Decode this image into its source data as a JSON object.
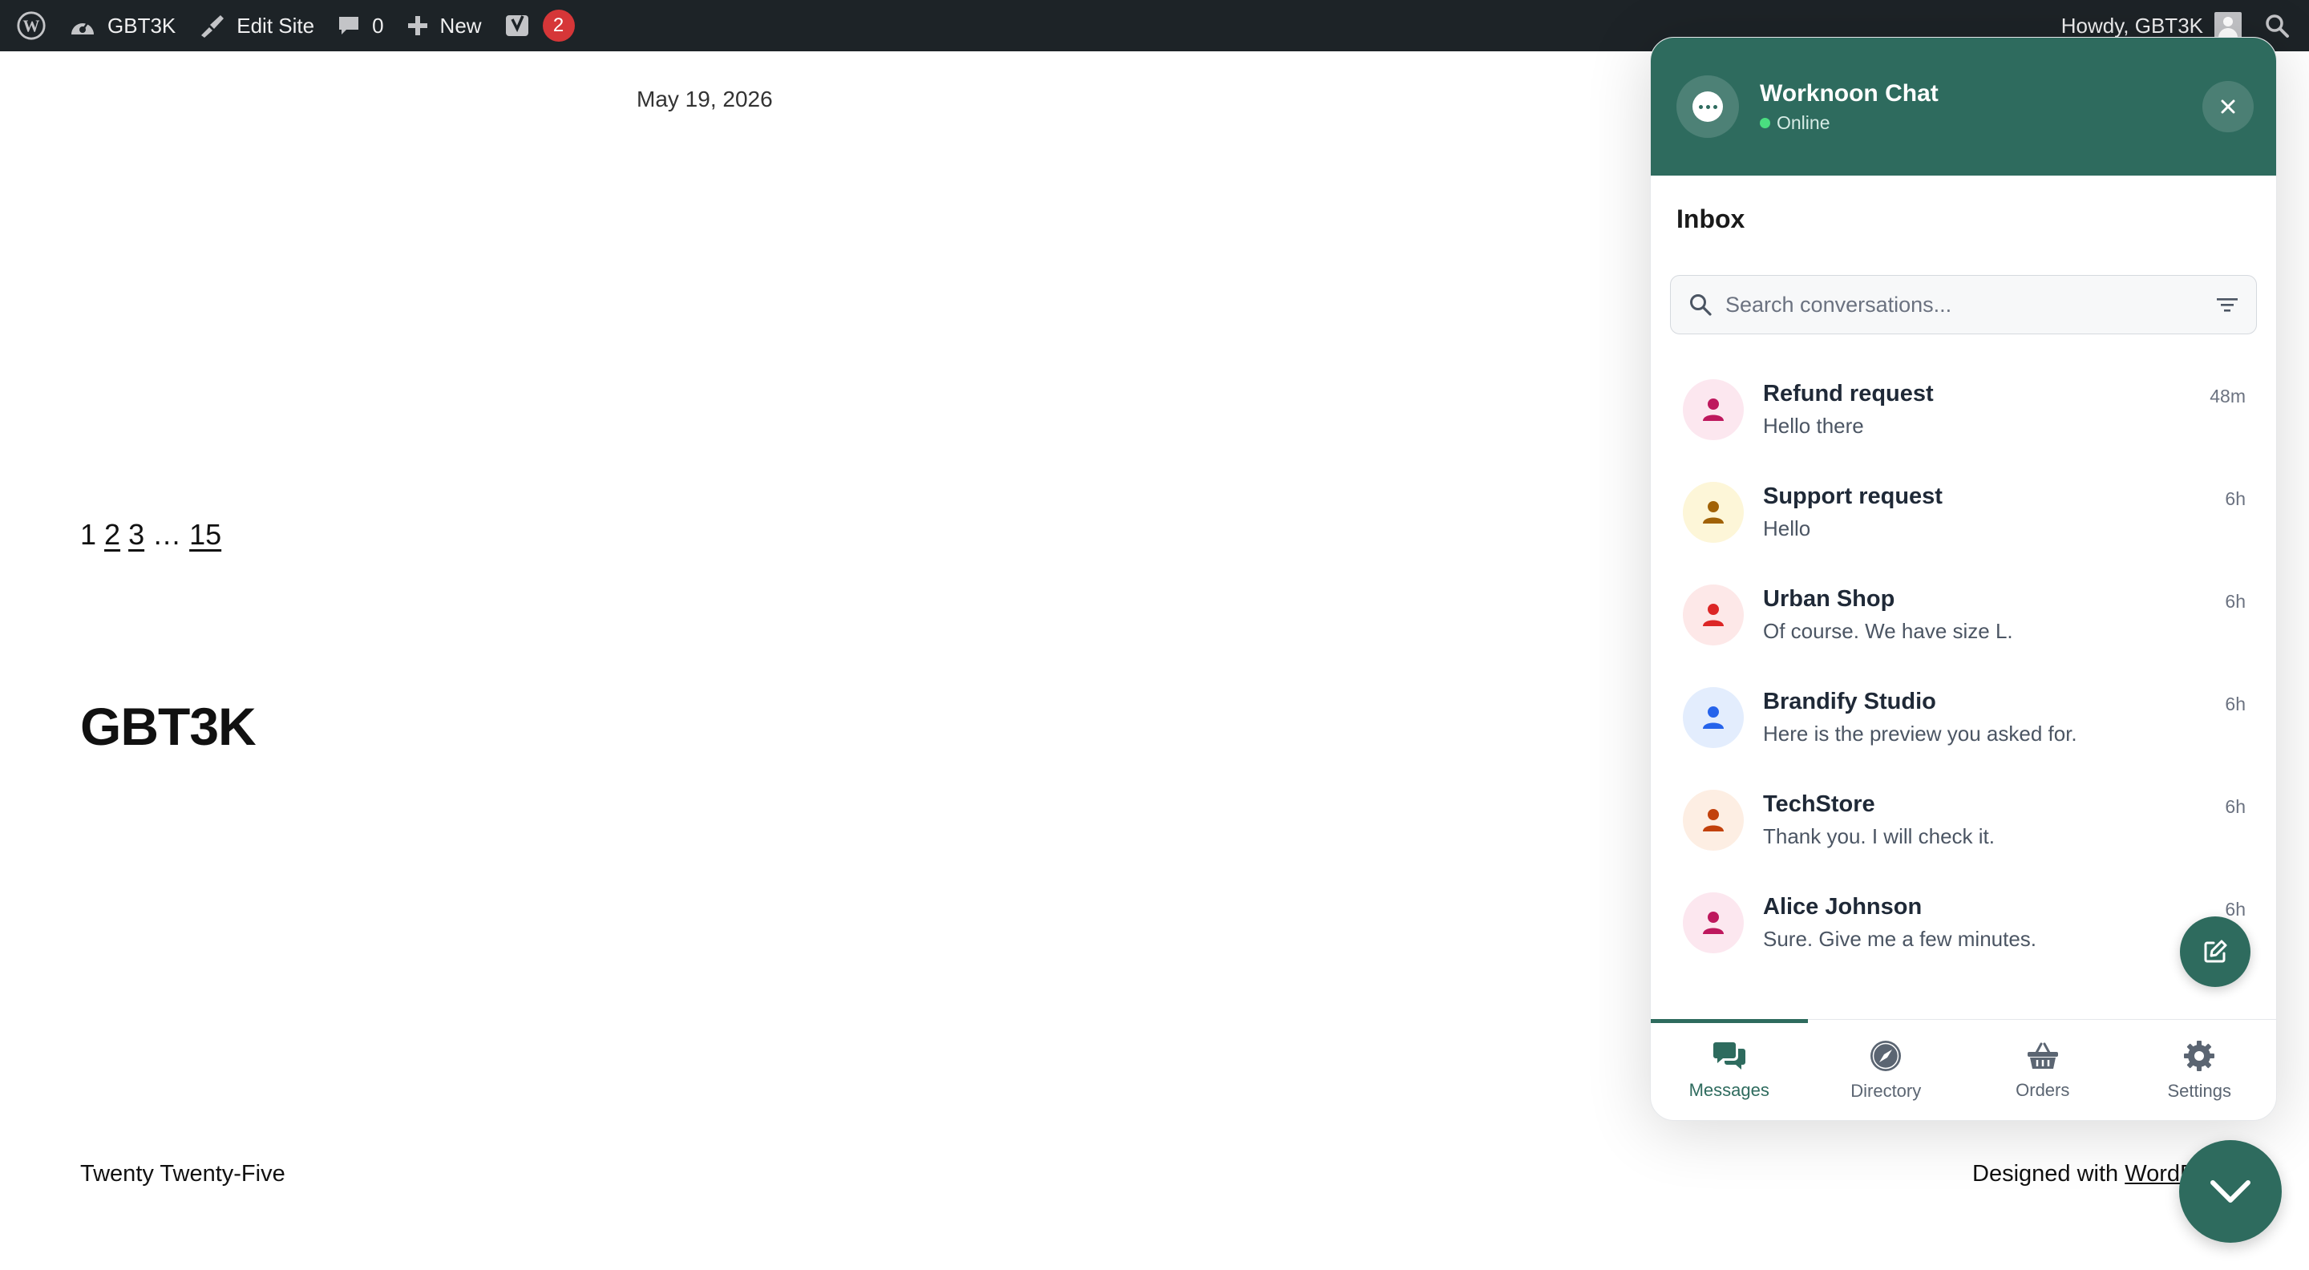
{
  "adminbar": {
    "site_name": "GBT3K",
    "edit_site": "Edit Site",
    "comments_count": "0",
    "new_label": "New",
    "yoast_badge": "2",
    "howdy": "Howdy, GBT3K"
  },
  "page": {
    "post_date": "May 19, 2026",
    "pagination": {
      "current": "1",
      "pages": [
        "2",
        "3"
      ],
      "ellipsis": "…",
      "last": "15"
    },
    "site_title": "GBT3K",
    "footer_left": "Twenty Twenty-Five",
    "footer_right_prefix": "Designed with ",
    "footer_right_link": "WordPress"
  },
  "widget": {
    "title": "Worknoon Chat",
    "status": "Online",
    "inbox_title": "Inbox",
    "search_placeholder": "Search conversations...",
    "conversations": [
      {
        "name": "Refund request",
        "preview": "Hello there",
        "time": "48m",
        "avatar_bg": "#fce7ef",
        "avatar_fg": "#be185d"
      },
      {
        "name": "Support request",
        "preview": "Hello",
        "time": "6h",
        "avatar_bg": "#fdf6d8",
        "avatar_fg": "#a16207"
      },
      {
        "name": "Urban Shop",
        "preview": "Of course. We have size L.",
        "time": "6h",
        "avatar_bg": "#fde8e8",
        "avatar_fg": "#dc2626"
      },
      {
        "name": "Brandify Studio",
        "preview": "Here is the preview you asked for.",
        "time": "6h",
        "avatar_bg": "#e3edfd",
        "avatar_fg": "#2563eb"
      },
      {
        "name": "TechStore",
        "preview": "Thank you. I will check it.",
        "time": "6h",
        "avatar_bg": "#fdeee3",
        "avatar_fg": "#c2410c"
      },
      {
        "name": "Alice Johnson",
        "preview": "Sure. Give me a few minutes.",
        "time": "6h",
        "avatar_bg": "#fce7ef",
        "avatar_fg": "#be185d"
      }
    ],
    "tabs": [
      {
        "label": "Messages",
        "icon": "chat-bubbles-icon",
        "active": true
      },
      {
        "label": "Directory",
        "icon": "compass-icon",
        "active": false
      },
      {
        "label": "Orders",
        "icon": "basket-icon",
        "active": false
      },
      {
        "label": "Settings",
        "icon": "gear-icon",
        "active": false
      }
    ],
    "accent_color": "#2e6b5e"
  }
}
